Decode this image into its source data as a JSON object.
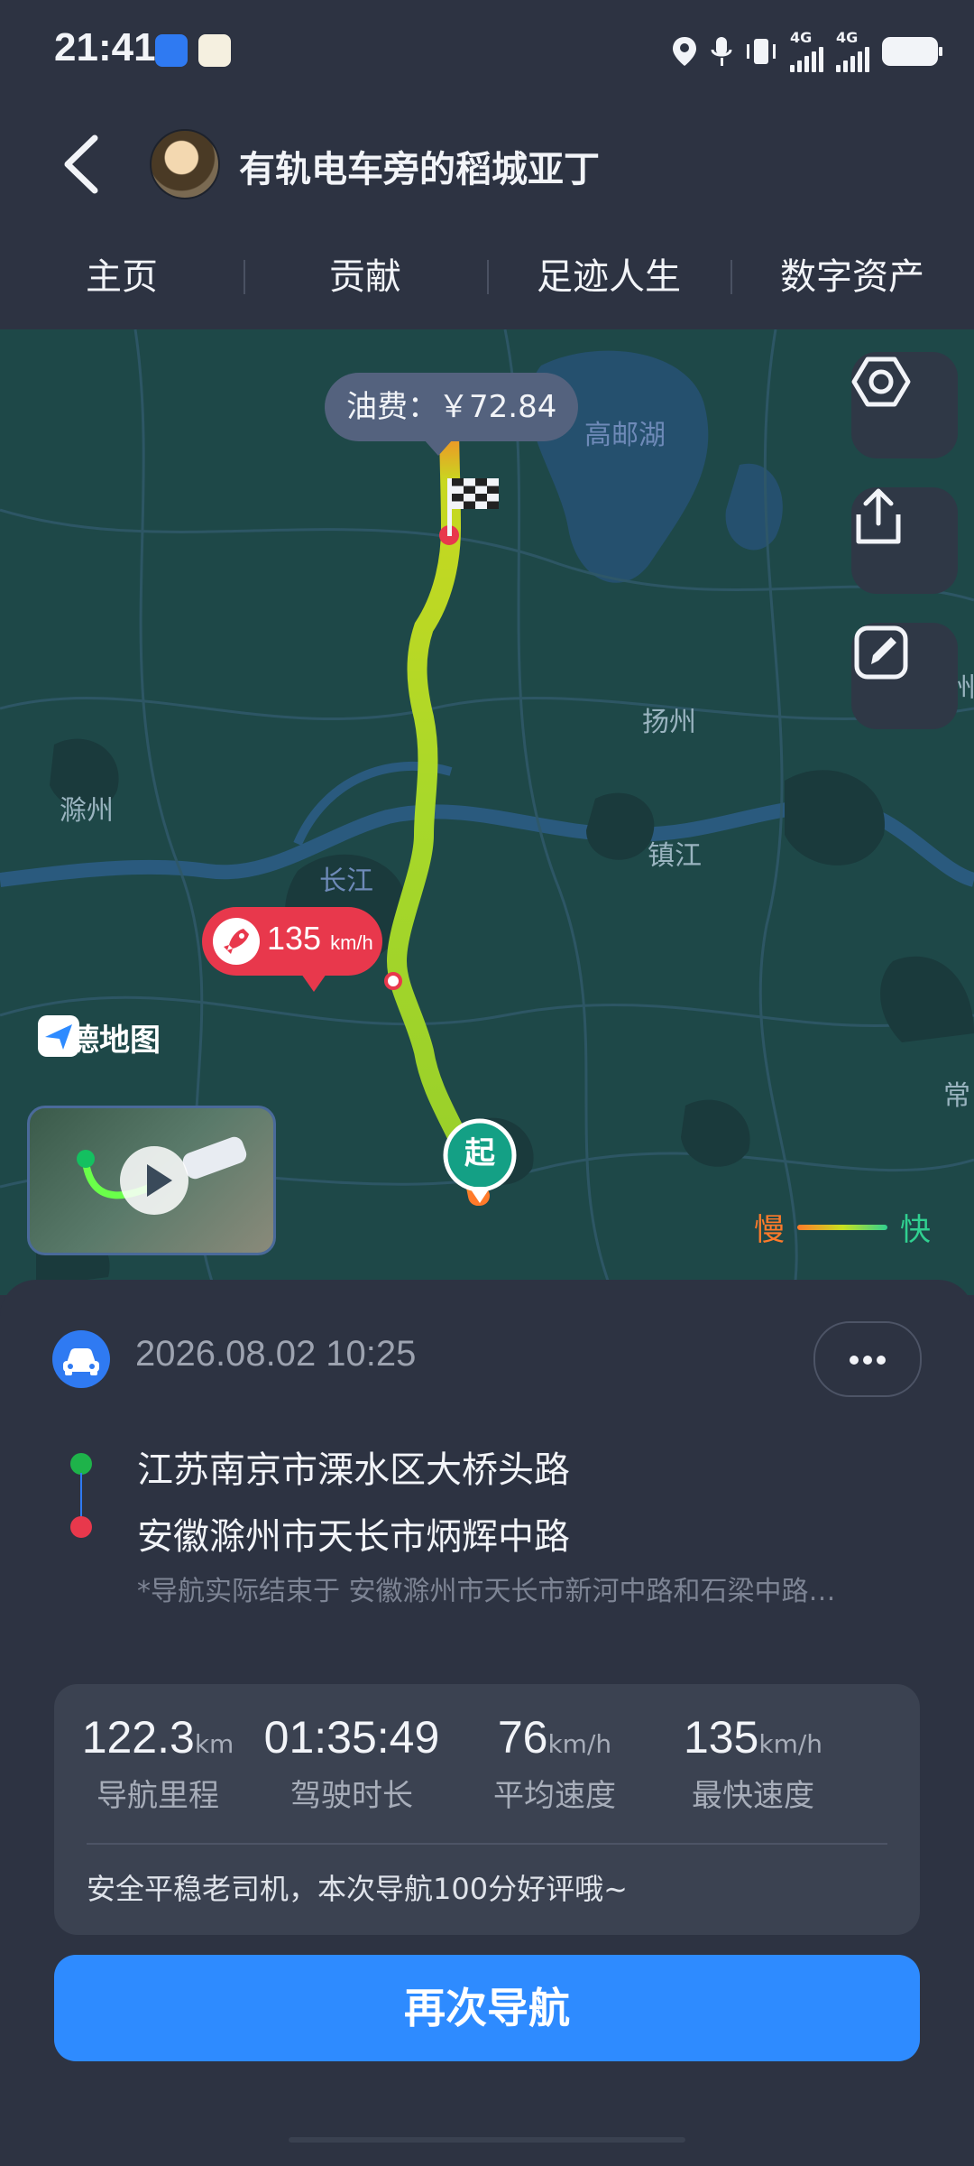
{
  "status_bar": {
    "time": "21:41",
    "network_1": "4G",
    "network_2": "4G"
  },
  "header": {
    "back_icon": "chevron-left-icon",
    "username": "有轨电车旁的稻城亚丁"
  },
  "tabs": [
    {
      "label": "主页"
    },
    {
      "label": "贡献"
    },
    {
      "label": "足迹人生"
    },
    {
      "label": "数字资产"
    }
  ],
  "map": {
    "fuel_label": "油费：￥72.84",
    "max_speed_value": "135",
    "max_speed_unit": "km/h",
    "start_marker": "起",
    "logo_text": "高德地图",
    "legend_slow": "慢",
    "legend_fast": "快",
    "place_labels": [
      "高邮湖",
      "扬州",
      "滁州",
      "镇江",
      "长江",
      "常",
      "州"
    ],
    "buttons": [
      {
        "icon": "hexagon-settings-icon"
      },
      {
        "icon": "share-icon"
      },
      {
        "icon": "edit-icon"
      }
    ],
    "colors": {
      "slow": "#ff7a2a",
      "mid": "#c8e020",
      "fast": "#30d090"
    }
  },
  "trip": {
    "datetime": "2026.08.02 10:25",
    "start_address": "江苏南京市溧水区大桥头路",
    "end_address": "安徽滁州市天长市炳辉中路",
    "end_note": "*导航实际结束于 安徽滁州市天长市新河中路和石梁中路…",
    "stats": [
      {
        "value": "122.3",
        "unit": "km",
        "label": "导航里程"
      },
      {
        "value": "01:35:49",
        "unit": "",
        "label": "驾驶时长"
      },
      {
        "value": "76",
        "unit": "km/h",
        "label": "平均速度"
      },
      {
        "value": "135",
        "unit": "km/h",
        "label": "最快速度"
      }
    ],
    "comment": "安全平稳老司机，本次导航100分好评哦~",
    "renavigate_label": "再次导航"
  },
  "accent_color": "#2e8bff"
}
